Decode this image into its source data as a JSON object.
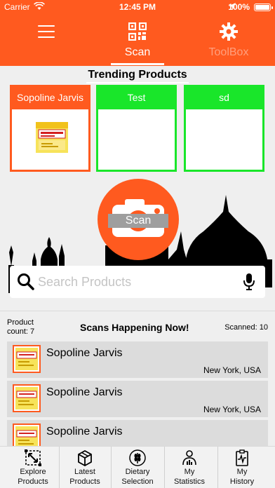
{
  "status_bar": {
    "carrier": "Carrier",
    "time": "12:45 PM",
    "battery_pct": "100%"
  },
  "header": {
    "tabs": [
      {
        "label": "Scan",
        "active": true,
        "icon": "qr-code-icon"
      },
      {
        "label": "ToolBox",
        "active": false,
        "icon": "gear-icon"
      }
    ]
  },
  "trending": {
    "title": "Trending Products",
    "cards": [
      {
        "name": "Sopoline Jarvis",
        "has_image": true
      },
      {
        "name": "Test",
        "has_image": false
      },
      {
        "name": "sd",
        "has_image": false
      }
    ]
  },
  "scan_button": {
    "label": "Scan"
  },
  "search": {
    "placeholder": "Search Products",
    "value": ""
  },
  "stats": {
    "product_count_label": "Product",
    "product_count_value": "count: 7",
    "title": "Scans Happening Now!",
    "scanned": "Scanned: 10"
  },
  "feed": [
    {
      "name": "Sopoline Jarvis",
      "location": "New York, USA"
    },
    {
      "name": "Sopoline Jarvis",
      "location": "New York, USA"
    },
    {
      "name": "Sopoline Jarvis",
      "location": ""
    }
  ],
  "bottom_nav": [
    {
      "line1": "Explore",
      "line2": "Products",
      "icon": "expand-icon"
    },
    {
      "line1": "Latest",
      "line2": "Products",
      "icon": "box-icon"
    },
    {
      "line1": "Dietary",
      "line2": "Selection",
      "icon": "wheat-icon"
    },
    {
      "line1": "My",
      "line2": "Statistics",
      "icon": "statistics-icon"
    },
    {
      "line1": "My",
      "line2": "History",
      "icon": "history-icon"
    }
  ],
  "colors": {
    "brand": "#ff5a1f",
    "accent_green": "#19e62a",
    "muted_tab": "#ff9f7d"
  }
}
